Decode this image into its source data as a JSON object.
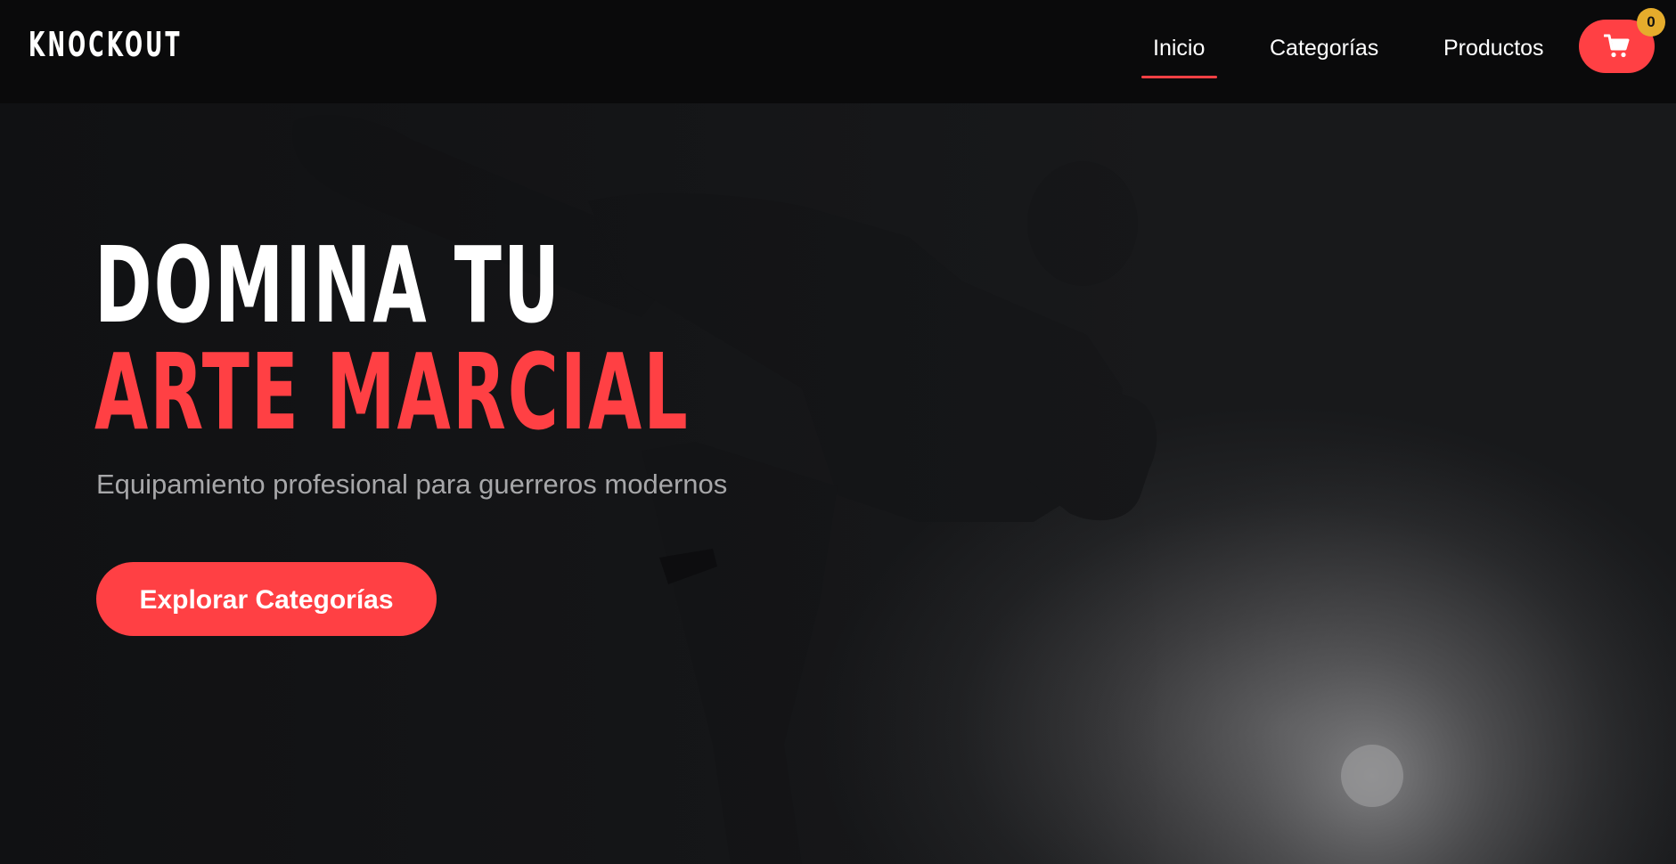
{
  "navbar": {
    "logo": "KNOCKOUT",
    "links": [
      {
        "label": "Inicio",
        "active": true
      },
      {
        "label": "Categorías",
        "active": false
      },
      {
        "label": "Productos",
        "active": false
      }
    ],
    "cart": {
      "icon": "cart-icon",
      "count": "0"
    }
  },
  "hero": {
    "title_line1": "DOMINA TU",
    "title_line2": "ARTE MARCIAL",
    "subtitle": "Equipamiento profesional para guerreros modernos",
    "cta_label": "Explorar Categorías",
    "background": "martial-artist-kick-silhouette"
  },
  "colors": {
    "accent": "#ff4044",
    "badge": "#e5ac2c",
    "navbar_bg": "#0a0a0b",
    "text_muted": "#a7a7a9"
  }
}
